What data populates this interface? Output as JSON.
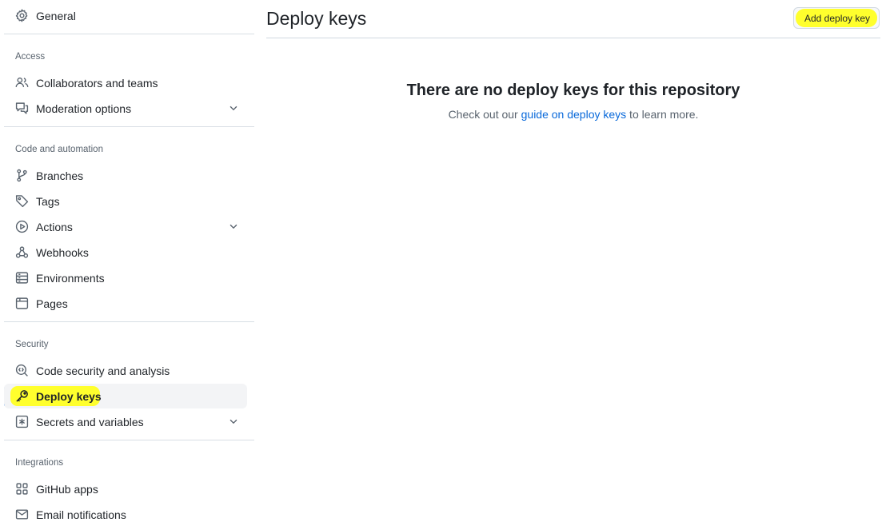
{
  "sidebar": {
    "general": {
      "label": "General",
      "icon": "gear-icon"
    },
    "sections": {
      "access": "Access",
      "code_automation": "Code and automation",
      "security": "Security",
      "integrations": "Integrations"
    },
    "items": {
      "collaborators": {
        "label": "Collaborators and teams",
        "icon": "people-icon"
      },
      "moderation": {
        "label": "Moderation options",
        "icon": "comment-discussion-icon"
      },
      "branches": {
        "label": "Branches",
        "icon": "git-branch-icon"
      },
      "tags": {
        "label": "Tags",
        "icon": "tag-icon"
      },
      "actions": {
        "label": "Actions",
        "icon": "play-icon"
      },
      "webhooks": {
        "label": "Webhooks",
        "icon": "webhook-icon"
      },
      "environments": {
        "label": "Environments",
        "icon": "server-icon"
      },
      "pages": {
        "label": "Pages",
        "icon": "browser-icon"
      },
      "code_security": {
        "label": "Code security and analysis",
        "icon": "codescan-icon"
      },
      "deploy_keys": {
        "label": "Deploy keys",
        "icon": "key-icon",
        "active": true
      },
      "secrets": {
        "label": "Secrets and variables",
        "icon": "asterisk-icon"
      },
      "github_apps": {
        "label": "GitHub apps",
        "icon": "apps-icon"
      },
      "email_notifications": {
        "label": "Email notifications",
        "icon": "mail-icon"
      }
    }
  },
  "main": {
    "title": "Deploy keys",
    "add_button": "Add deploy key",
    "blankslate": {
      "heading": "There are no deploy keys for this repository",
      "desc_prefix": "Check out our ",
      "link": "guide on deploy keys",
      "desc_suffix": " to learn more."
    }
  },
  "colors": {
    "accent": "#0969da",
    "highlight": "#ffff2d",
    "muted_text": "#59636e",
    "border": "#d1d9e0"
  }
}
